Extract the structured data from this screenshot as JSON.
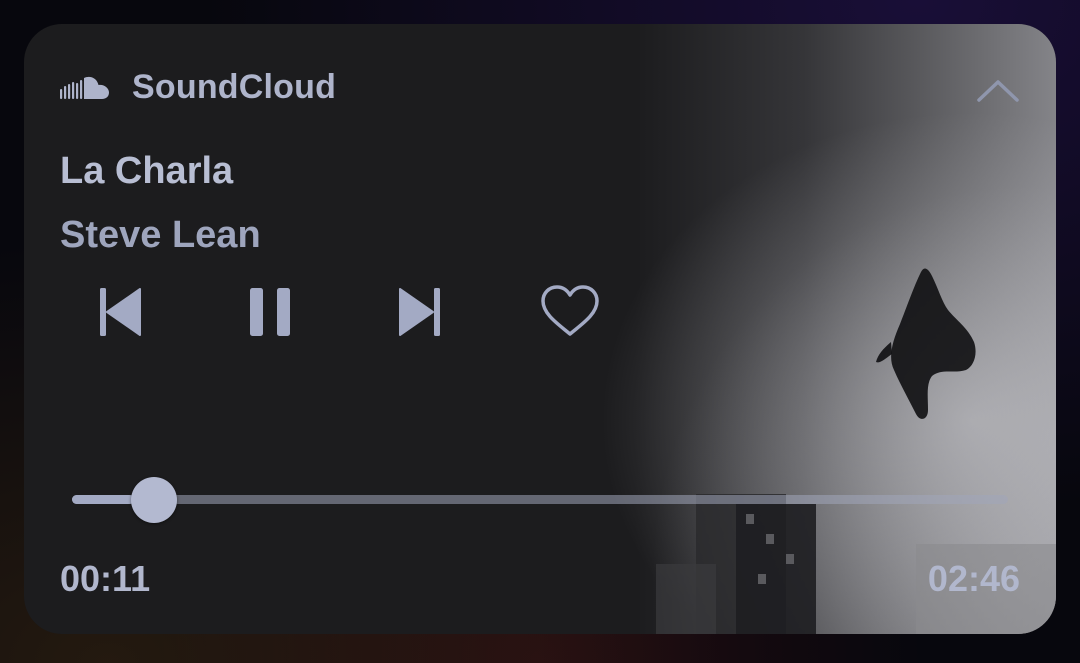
{
  "app": {
    "name": "SoundCloud",
    "icon": "soundcloud-logo-icon"
  },
  "track": {
    "title": "La Charla",
    "artist": "Steve Lean"
  },
  "controls": {
    "previous_icon": "skip-previous-icon",
    "pause_icon": "pause-icon",
    "next_icon": "skip-next-icon",
    "like_icon": "heart-outline-icon",
    "collapse_icon": "chevron-up-icon"
  },
  "playback": {
    "elapsed": "00:11",
    "duration": "02:46",
    "progress_fraction": 0.066,
    "state": "playing"
  },
  "colors": {
    "card_background": "#1c1c1e",
    "text_primary": "#b8bed3",
    "accent": "#a3aac4"
  }
}
